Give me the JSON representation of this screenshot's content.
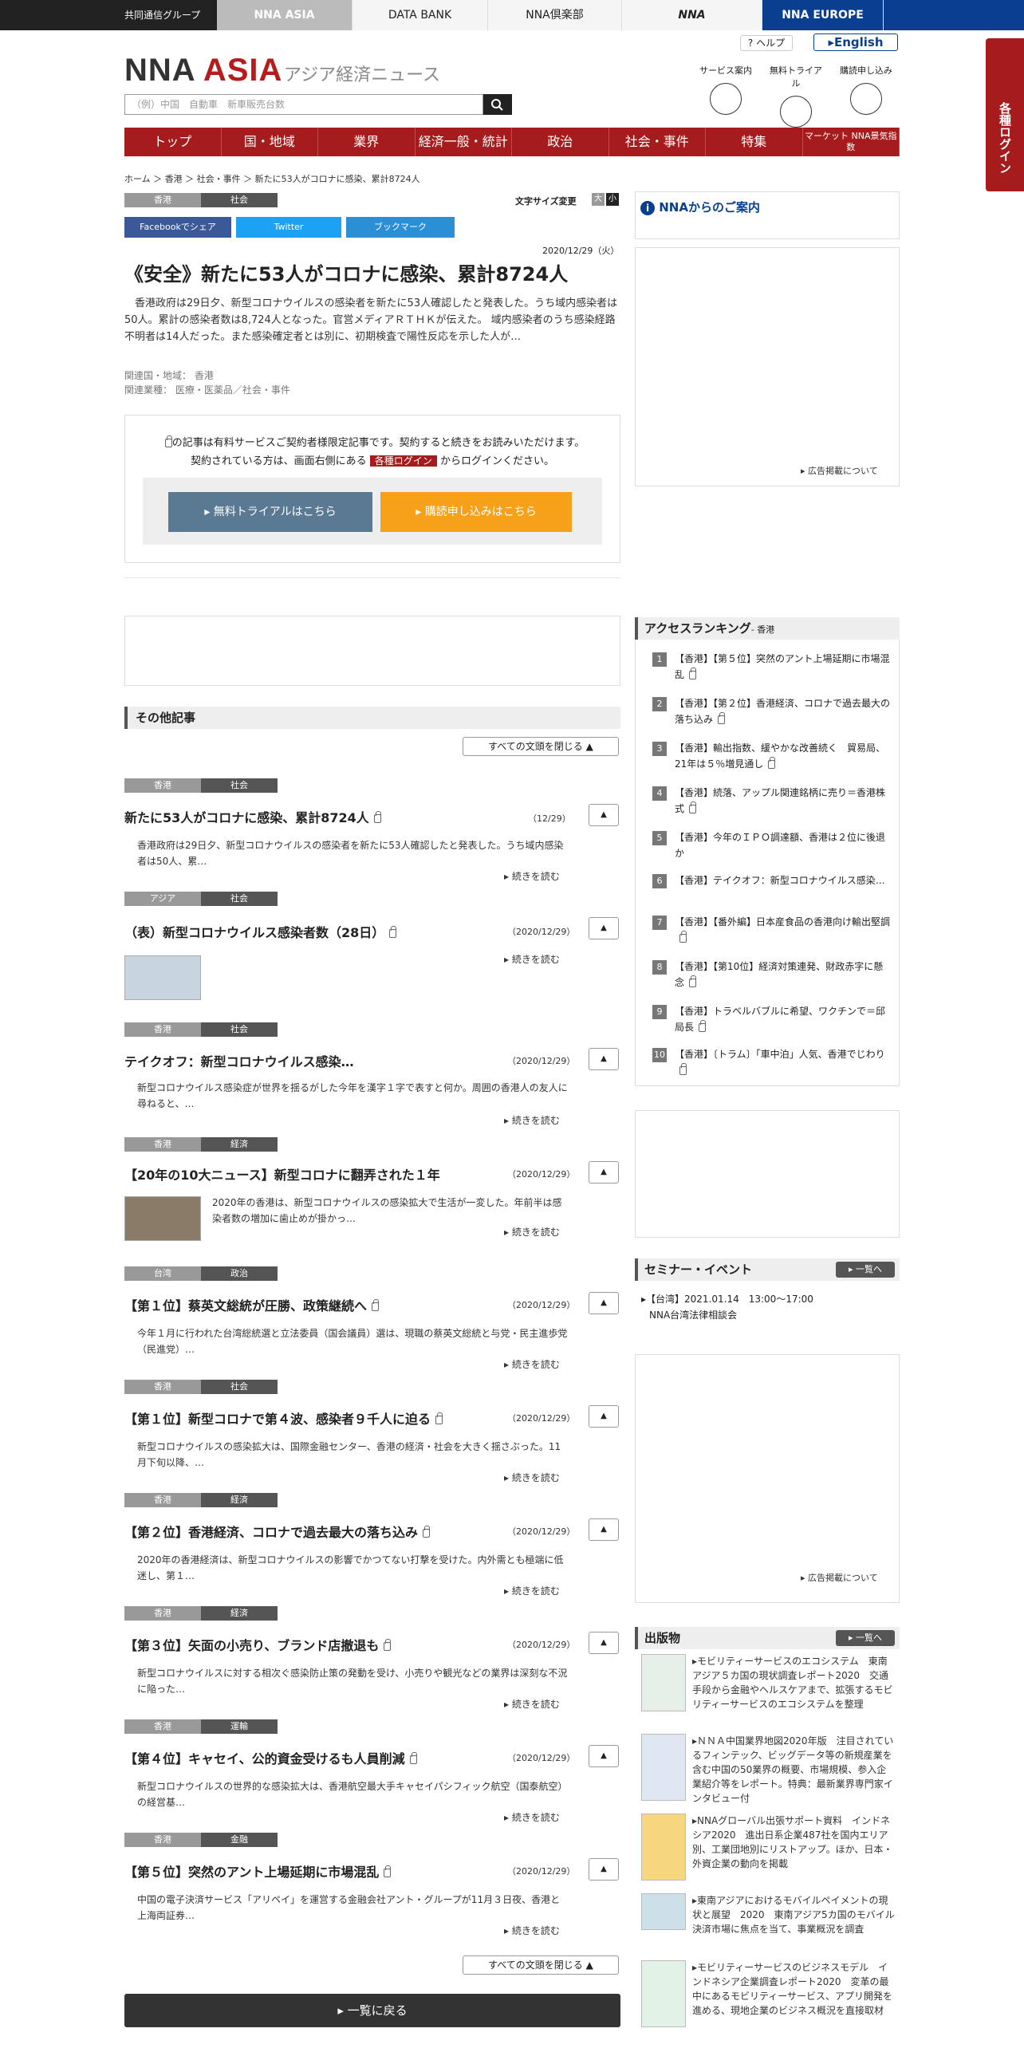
{
  "topbar": {
    "group": "共同通信グループ",
    "tabs": [
      "NNA ASIA",
      "DATA BANK",
      "NNA倶楽部",
      "NNA",
      "NNA EUROPE"
    ]
  },
  "header": {
    "logo_main": "NNA",
    "logo_asia": "ASIA",
    "logo_sub": "アジア経済ニュース",
    "search_placeholder": "（例）中国　自動車　新車販売台数",
    "help": "? ヘルプ",
    "english": "▸English",
    "services": [
      "サービス案内",
      "無料トライアル",
      "購読申し込み"
    ]
  },
  "nav": [
    "トップ",
    "国・地域",
    "業界",
    "経済一般・統計",
    "政治",
    "社会・事件",
    "特集",
    "マーケット NNA景気指数"
  ],
  "side_login": "各種ログイン",
  "breadcrumb": [
    "ホーム",
    "香港",
    "社会・事件",
    "新たに53人がコロナに感染、累計8724人"
  ],
  "article": {
    "region": "香港",
    "category": "社会",
    "font_size_label": "文字サイズ変更",
    "font_sizes": [
      "大",
      "小"
    ],
    "share": [
      "Facebookでシェア",
      "Twitter",
      "ブックマーク"
    ],
    "date": "2020/12/29（火）",
    "title": "《安全》新たに53人がコロナに感染、累計8724人",
    "body": "香港政府は29日夕、新型コロナウイルスの感染者を新たに53人確認したと発表した。うち域内感染者は50人。累計の感染者数は8,724人となった。官営メディアＲＴＨＫが伝えた。 域内感染者のうち感染経路不明者は14人だった。また感染確定者とは別に、初期検査で陽性反応を示した人が…",
    "related_region": "関連国・地域：  香港",
    "related_industry": "関連業種：  医療・医薬品／社会・事件"
  },
  "paywall": {
    "line1": "の記事は有料サービスご契約者様限定記事です。契約すると続きをお読みいただけます。",
    "line2_pre": "契約されている方は、画面右側にある",
    "login": "各種ログイン",
    "line2_post": "からログインください。",
    "trial": "▸ 無料トライアルはこちら",
    "subscribe": "▸ 購読申し込みはこちら"
  },
  "other": {
    "heading": "その他記事",
    "close_all": "すべての文頭を閉じる ▲",
    "more": "▸ 続きを読む",
    "toggle": "▲",
    "items": [
      {
        "region": "香港",
        "category": "社会",
        "title": "新たに53人がコロナに感染、累計8724人",
        "date": "（12/29）",
        "body": "香港政府は29日夕、新型コロナウイルスの感染者を新たに53人確認したと発表した。うち域内感染者は50人、累…"
      },
      {
        "region": "アジア",
        "category": "社会",
        "title": "（表）新型コロナウイルス感染者数（28日）",
        "date": "（2020/12/29）",
        "body": ""
      },
      {
        "region": "香港",
        "category": "社会",
        "title": "テイクオフ：新型コロナウイルス感染…",
        "date": "（2020/12/29）",
        "body": "新型コロナウイルス感染症が世界を揺るがした今年を漢字１字で表すと何か。周囲の香港人の友人に尋ねると、…"
      },
      {
        "region": "香港",
        "category": "経済",
        "title": "【20年の10大ニュース】新型コロナに翻弄された１年",
        "date": "（2020/12/29）",
        "body": "2020年の香港は、新型コロナウイルスの感染拡大で生活が一変した。年前半は感染者数の増加に歯止めが掛かっ…"
      },
      {
        "region": "台湾",
        "category": "政治",
        "title": "【第１位】蔡英文総統が圧勝、政策継続へ",
        "date": "（2020/12/29）",
        "body": "今年１月に行われた台湾総統選と立法委員（国会議員）選は、現職の蔡英文総統と与党・民主進歩党（民進党）…"
      },
      {
        "region": "香港",
        "category": "社会",
        "title": "【第１位】新型コロナで第４波、感染者９千人に迫る",
        "date": "（2020/12/29）",
        "body": "新型コロナウイルスの感染拡大は、国際金融センター、香港の経済・社会を大きく揺さぶった。11月下旬以降、…"
      },
      {
        "region": "香港",
        "category": "経済",
        "title": "【第２位】香港経済、コロナで過去最大の落ち込み",
        "date": "（2020/12/29）",
        "body": "2020年の香港経済は、新型コロナウイルスの影響でかつてない打撃を受けた。内外需とも極端に低迷し、第１…"
      },
      {
        "region": "香港",
        "category": "経済",
        "title": "【第３位】矢面の小売り、ブランド店撤退も",
        "date": "（2020/12/29）",
        "body": "新型コロナウイルスに対する相次ぐ感染防止策の発動を受け、小売りや観光などの業界は深刻な不況に陥った…"
      },
      {
        "region": "香港",
        "category": "運輸",
        "title": "【第４位】キャセイ、公的資金受けるも人員削減",
        "date": "（2020/12/29）",
        "body": "新型コロナウイルスの世界的な感染拡大は、香港航空最大手キャセイパシフィック航空（国泰航空）の経営基…"
      },
      {
        "region": "香港",
        "category": "金融",
        "title": "【第５位】突然のアント上場延期に市場混乱",
        "date": "（2020/12/29）",
        "body": "中国の電子決済サービス「アリペイ」を運営する金融会社アント・グループが11月３日夜、香港と上海両証券…"
      }
    ],
    "back": "▸ 一覧に戻る"
  },
  "right": {
    "nna_info": "NNAからのご案内",
    "ad_note": "▸ 広告掲載について",
    "ranking_title": "アクセスランキング",
    "ranking_sub": "- 香港",
    "ranking": [
      "【香港】【第５位】突然のアント上場延期に市場混乱",
      "【香港】【第２位】香港経済、コロナで過去最大の落ち込み",
      "【香港】輸出指数、緩やかな改善続く　貿易局、21年は５％増見通し",
      "【香港】続落、アップル関連銘柄に売り＝香港株式",
      "【香港】今年のＩＰＯ調達額、香港は２位に後退か",
      "【香港】テイクオフ：新型コロナウイルス感染…",
      "【香港】【番外編】日本産食品の香港向け輸出堅調",
      "【香港】【第10位】経済対策連発、財政赤字に懸念",
      "【香港】トラベルバブルに希望、ワクチンで＝邱局長",
      "【香港】〔トラム〕「車中泊」人気、香港でじわり"
    ],
    "seminar_title": "セミナー・イベント",
    "list_btn": "▸ 一覧へ",
    "seminar_date": "▸【台湾】2021.01.14　13:00～17:00",
    "seminar_name": "NNA台湾法律相談会",
    "pub_title": "出版物",
    "pubs": [
      "▸モビリティーサービスのエコシステム　東南アジア５カ国の現状調査レポート2020　交通手段から金融やヘルスケアまで、拡張するモビリティーサービスのエコシステムを整理",
      "▸ＮＮＡ中国業界地図2020年版　注目されているフィンテック、ビッグデータ等の新規産業を含む中国の50業界の概要、市場規模、参入企業紹介等をレポート。特典：最新業界専門家インタビュー付",
      "▸NNAグローバル出張サポート資料　インドネシア2020　進出日系企業487社を国内エリア別、工業団地別にリストアップ。ほか、日本・外資企業の動向を掲載",
      "▸東南アジアにおけるモバイルペイメントの現状と展望　2020　東南アジア5カ国のモバイル決済市場に焦点を当て、事業概況を調査",
      "▸モビリティーサービスのビジネスモデル　インドネシア企業調査レポート2020　変革の最中にあるモビリティーサービス、アプリ開発を進める、現地企業のビジネス概況を直接取材"
    ]
  }
}
